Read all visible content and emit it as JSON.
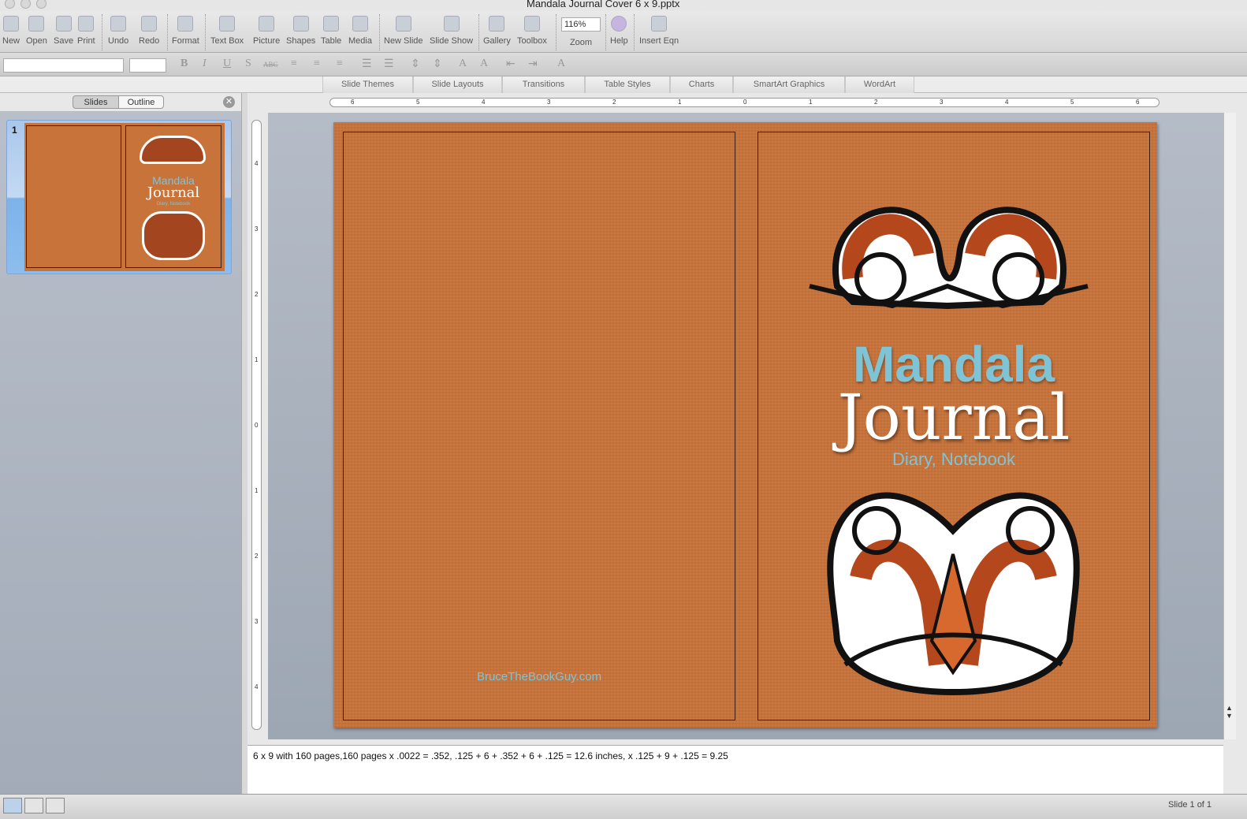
{
  "window": {
    "title": "Mandala Journal Cover 6 x 9.pptx"
  },
  "toolbar": {
    "items": [
      "New",
      "Open",
      "Save",
      "Print",
      "Undo",
      "Redo",
      "Format",
      "Text Box",
      "Picture",
      "Shapes",
      "Table",
      "Media",
      "New Slide",
      "Slide Show",
      "Gallery",
      "Toolbox",
      "Zoom",
      "Help",
      "Insert Eqn"
    ],
    "zoom_value": "116%"
  },
  "formatbar": {
    "font_name": "",
    "font_size": "",
    "buttons": [
      "B",
      "I",
      "U",
      "S",
      "ABC",
      "A",
      "A",
      "A"
    ]
  },
  "ribbon": {
    "tabs": [
      "Slide Themes",
      "Slide Layouts",
      "Transitions",
      "Table Styles",
      "Charts",
      "SmartArt Graphics",
      "WordArt"
    ]
  },
  "leftpane": {
    "tabs": [
      "Slides",
      "Outline"
    ],
    "slide_number": "1"
  },
  "ruler": {
    "h_labels": [
      "6",
      "5",
      "4",
      "3",
      "2",
      "1",
      "0",
      "1",
      "2",
      "3",
      "4",
      "5",
      "6"
    ],
    "v_labels": [
      "4",
      "3",
      "2",
      "1",
      "0",
      "1",
      "2",
      "3",
      "4"
    ]
  },
  "slide": {
    "title1": "Mandala",
    "title2": "Journal",
    "subtitle": "Diary, Notebook",
    "footer": "BruceTheBookGuy.com"
  },
  "colors": {
    "cover": "#c8733a",
    "title_blue": "#7ec4d6",
    "text_white": "#ffffff"
  },
  "notes": {
    "text": "6 x 9 with 160 pages,160 pages x .0022 = .352,  .125 + 6 + .352 + 6 + .125  = 12.6 inches, x .125 + 9 + .125 = 9.25"
  },
  "status": {
    "slide_info": "Slide 1 of 1"
  }
}
